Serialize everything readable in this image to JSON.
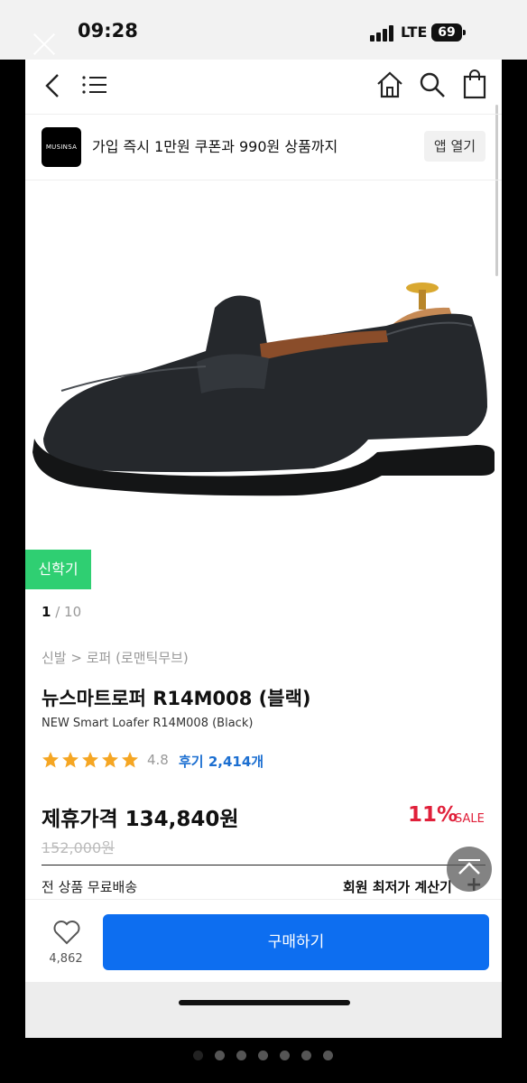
{
  "status_bar": {
    "time": "09:28",
    "network": "LTE",
    "battery": "69"
  },
  "banner": {
    "logo_text": "MUSINSA",
    "text": "가입 즉시 1만원 쿠폰과 990원 상품까지",
    "app_button": "앱 열기"
  },
  "gallery": {
    "badge": "신학기",
    "current": "1",
    "total": "/ 10"
  },
  "product": {
    "breadcrumb": "신발 > 로퍼 (로맨틱무브)",
    "title": "뉴스마트로퍼 R14M008 (블랙)",
    "subtitle": "NEW Smart Loafer R14M008 (Black)",
    "rating": "4.8",
    "reviews": "후기 2,414개",
    "stars": 5
  },
  "price": {
    "label": "제휴가격 134,840원",
    "discount": "11%",
    "sale": "SALE",
    "original": "152,000원"
  },
  "shipping": {
    "free": "전 상품 무료배송",
    "member_calc": "회원 최저가 계산기"
  },
  "bottom_bar": {
    "like_count": "4,862",
    "buy_label": "구매하기"
  },
  "colors": {
    "accent_blue": "#0d6ef0",
    "discount_red": "#e0203a",
    "badge_green": "#2fcf72",
    "star": "#f5a623"
  },
  "icons": [
    "close-icon",
    "back-icon",
    "menu-icon",
    "home-icon",
    "search-icon",
    "shopping-bag-icon",
    "star-icon",
    "heart-icon",
    "arrow-up-icon",
    "plus-icon"
  ]
}
